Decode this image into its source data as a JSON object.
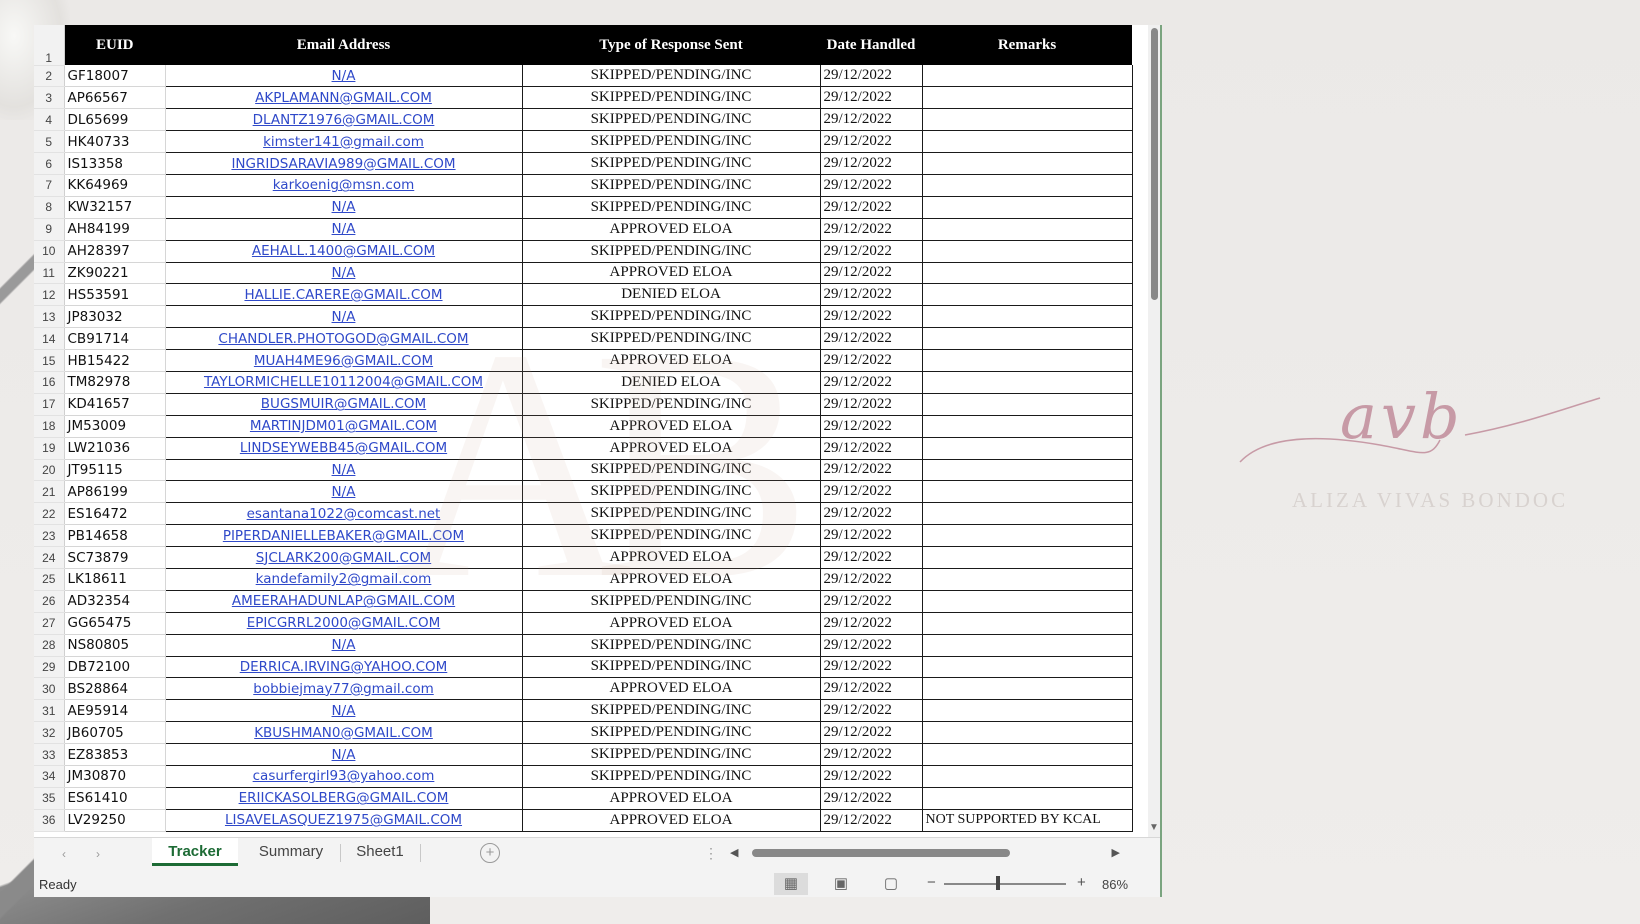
{
  "sheet": {
    "headers": {
      "row_number": "1",
      "euid": "EUID",
      "email": "Email Address",
      "type": "Type of Response Sent",
      "date": "Date Handled",
      "remarks": "Remarks"
    },
    "rows": [
      {
        "n": "2",
        "euid": "GF18007",
        "email": "N/A",
        "type": "SKIPPED/PENDING/INC",
        "date": "29/12/2022",
        "remarks": ""
      },
      {
        "n": "3",
        "euid": "AP66567",
        "email": "AKPLAMANN@GMAIL.COM",
        "type": "SKIPPED/PENDING/INC",
        "date": "29/12/2022",
        "remarks": ""
      },
      {
        "n": "4",
        "euid": "DL65699",
        "email": "DLANTZ1976@GMAIL.COM",
        "type": "SKIPPED/PENDING/INC",
        "date": "29/12/2022",
        "remarks": ""
      },
      {
        "n": "5",
        "euid": "HK40733",
        "email": "kimster141@gmail.com",
        "type": "SKIPPED/PENDING/INC",
        "date": "29/12/2022",
        "remarks": ""
      },
      {
        "n": "6",
        "euid": "IS13358",
        "email": "INGRIDSARAVIA989@GMAIL.COM",
        "type": "SKIPPED/PENDING/INC",
        "date": "29/12/2022",
        "remarks": ""
      },
      {
        "n": "7",
        "euid": "KK64969",
        "email": "karkoenig@msn.com",
        "type": "SKIPPED/PENDING/INC",
        "date": "29/12/2022",
        "remarks": ""
      },
      {
        "n": "8",
        "euid": "KW32157",
        "email": "N/A",
        "type": "SKIPPED/PENDING/INC",
        "date": "29/12/2022",
        "remarks": ""
      },
      {
        "n": "9",
        "euid": "AH84199",
        "email": "N/A",
        "type": "APPROVED ELOA",
        "date": "29/12/2022",
        "remarks": ""
      },
      {
        "n": "10",
        "euid": "AH28397",
        "email": "AEHALL.1400@GMAIL.COM",
        "type": "SKIPPED/PENDING/INC",
        "date": "29/12/2022",
        "remarks": ""
      },
      {
        "n": "11",
        "euid": "ZK90221",
        "email": "N/A",
        "type": "APPROVED ELOA",
        "date": "29/12/2022",
        "remarks": ""
      },
      {
        "n": "12",
        "euid": "HS53591",
        "email": "HALLIE.CARERE@GMAIL.COM",
        "type": "DENIED ELOA",
        "date": "29/12/2022",
        "remarks": ""
      },
      {
        "n": "13",
        "euid": "JP83032",
        "email": "N/A",
        "type": "SKIPPED/PENDING/INC",
        "date": "29/12/2022",
        "remarks": ""
      },
      {
        "n": "14",
        "euid": "CB91714",
        "email": "CHANDLER.PHOTOGOD@GMAIL.COM",
        "type": "SKIPPED/PENDING/INC",
        "date": "29/12/2022",
        "remarks": ""
      },
      {
        "n": "15",
        "euid": "HB15422",
        "email": "MUAH4ME96@GMAIL.COM",
        "type": "APPROVED ELOA",
        "date": "29/12/2022",
        "remarks": ""
      },
      {
        "n": "16",
        "euid": "TM82978",
        "email": "TAYLORMICHELLE10112004@GMAIL.COM",
        "type": "DENIED ELOA",
        "date": "29/12/2022",
        "remarks": ""
      },
      {
        "n": "17",
        "euid": "KD41657",
        "email": "BUGSMUIR@GMAIL.COM",
        "type": "SKIPPED/PENDING/INC",
        "date": "29/12/2022",
        "remarks": ""
      },
      {
        "n": "18",
        "euid": "JM53009",
        "email": "MARTINJDM01@GMAIL.COM",
        "type": "APPROVED ELOA",
        "date": "29/12/2022",
        "remarks": ""
      },
      {
        "n": "19",
        "euid": "LW21036",
        "email": "LINDSEYWEBB45@GMAIL.COM",
        "type": "APPROVED ELOA",
        "date": "29/12/2022",
        "remarks": ""
      },
      {
        "n": "20",
        "euid": "JT95115",
        "email": "N/A",
        "type": "SKIPPED/PENDING/INC",
        "date": "29/12/2022",
        "remarks": ""
      },
      {
        "n": "21",
        "euid": "AP86199",
        "email": "N/A",
        "type": "SKIPPED/PENDING/INC",
        "date": "29/12/2022",
        "remarks": ""
      },
      {
        "n": "22",
        "euid": "ES16472",
        "email": "esantana1022@comcast.net",
        "type": "SKIPPED/PENDING/INC",
        "date": "29/12/2022",
        "remarks": ""
      },
      {
        "n": "23",
        "euid": "PB14658",
        "email": "PIPERDANIELLEBAKER@GMAIL.COM",
        "type": "SKIPPED/PENDING/INC",
        "date": "29/12/2022",
        "remarks": ""
      },
      {
        "n": "24",
        "euid": "SC73879",
        "email": "SJCLARK200@GMAIL.COM",
        "type": "APPROVED ELOA",
        "date": "29/12/2022",
        "remarks": ""
      },
      {
        "n": "25",
        "euid": "LK18611",
        "email": "kandefamily2@gmail.com",
        "type": "APPROVED ELOA",
        "date": "29/12/2022",
        "remarks": ""
      },
      {
        "n": "26",
        "euid": "AD32354",
        "email": "AMEERAHADUNLAP@GMAIL.COM",
        "type": "SKIPPED/PENDING/INC",
        "date": "29/12/2022",
        "remarks": ""
      },
      {
        "n": "27",
        "euid": "GG65475",
        "email": "EPICGRRL2000@GMAIL.COM",
        "type": "APPROVED ELOA",
        "date": "29/12/2022",
        "remarks": ""
      },
      {
        "n": "28",
        "euid": "NS80805",
        "email": "N/A",
        "type": "SKIPPED/PENDING/INC",
        "date": "29/12/2022",
        "remarks": ""
      },
      {
        "n": "29",
        "euid": "DB72100",
        "email": "DERRICA.IRVING@YAHOO.COM",
        "type": "SKIPPED/PENDING/INC",
        "date": "29/12/2022",
        "remarks": ""
      },
      {
        "n": "30",
        "euid": "BS28864",
        "email": "bobbiejmay77@gmail.com",
        "type": "APPROVED ELOA",
        "date": "29/12/2022",
        "remarks": ""
      },
      {
        "n": "31",
        "euid": "AE95914",
        "email": "N/A",
        "type": "SKIPPED/PENDING/INC",
        "date": "29/12/2022",
        "remarks": ""
      },
      {
        "n": "32",
        "euid": "JB60705",
        "email": "KBUSHMAN0@GMAIL.COM",
        "type": "SKIPPED/PENDING/INC",
        "date": "29/12/2022",
        "remarks": ""
      },
      {
        "n": "33",
        "euid": "EZ83853",
        "email": "N/A",
        "type": "SKIPPED/PENDING/INC",
        "date": "29/12/2022",
        "remarks": ""
      },
      {
        "n": "34",
        "euid": "JM30870",
        "email": "casurfergirl93@yahoo.com",
        "type": "SKIPPED/PENDING/INC",
        "date": "29/12/2022",
        "remarks": ""
      },
      {
        "n": "35",
        "euid": "ES61410",
        "email": "ERIICKASOLBERG@GMAIL.COM",
        "type": "APPROVED ELOA",
        "date": "29/12/2022",
        "remarks": ""
      },
      {
        "n": "36",
        "euid": "LV29250",
        "email": "LISAVELASQUEZ1975@GMAIL.COM",
        "type": "APPROVED ELOA",
        "date": "29/12/2022",
        "remarks": "NOT SUPPORTED BY KCAL"
      }
    ]
  },
  "tabs": {
    "items": [
      "Tracker",
      "Summary",
      "Sheet1"
    ],
    "active": "Tracker"
  },
  "status": {
    "ready": "Ready",
    "zoom": "86%"
  },
  "icons": {
    "prev_sheet": "chevron-left-icon",
    "next_sheet": "chevron-right-icon",
    "add_sheet": "plus-circle-icon",
    "normal_view": "grid-view-icon",
    "page_layout": "page-layout-icon",
    "page_break": "page-break-icon"
  },
  "brand": {
    "script": "avb",
    "name": "ALIZA VIVAS BONDOC"
  },
  "colors": {
    "header_bg": "#000000",
    "link": "#2f49c9",
    "active_tab": "#1d6b35",
    "brand_script": "#c79aa6"
  }
}
